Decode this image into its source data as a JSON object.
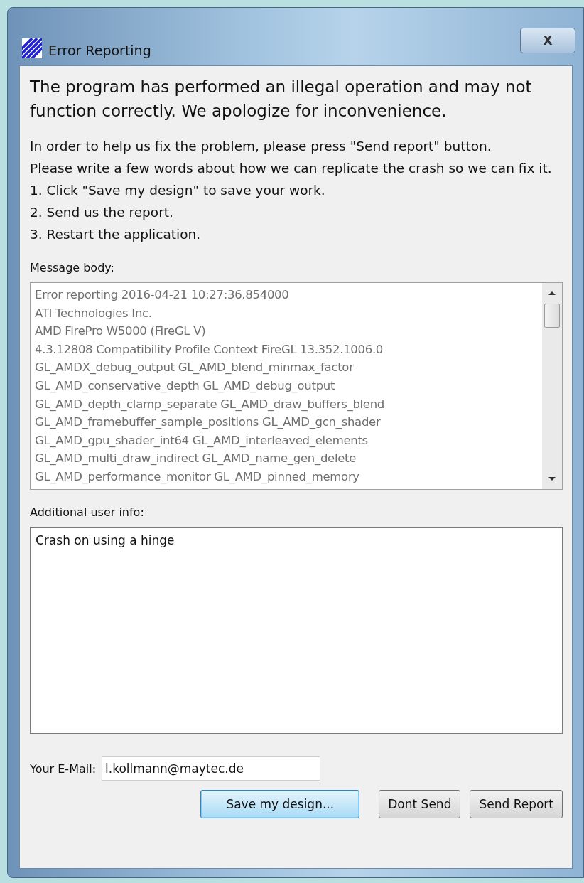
{
  "window": {
    "title": "Error Reporting",
    "close": "X"
  },
  "heading": "The program has performed an illegal operation and may not function correctly. We apologize for inconvenience.",
  "instructions": [
    "In order to help us fix the problem, please press \"Send report\" button.",
    "Please write a few words about how we can replicate the crash so we can fix it.",
    "1. Click \"Save my design\" to save your work.",
    "2. Send us the report.",
    "3. Restart the application."
  ],
  "message_body": {
    "label": "Message body:",
    "lines": [
      "Error reporting 2016-04-21 10:27:36.854000",
      "ATI Technologies Inc.",
      "AMD FirePro W5000 (FireGL V)",
      "4.3.12808 Compatibility Profile Context FireGL 13.352.1006.0",
      "GL_AMDX_debug_output GL_AMD_blend_minmax_factor",
      "GL_AMD_conservative_depth GL_AMD_debug_output",
      "GL_AMD_depth_clamp_separate GL_AMD_draw_buffers_blend",
      "GL_AMD_framebuffer_sample_positions GL_AMD_gcn_shader",
      "GL_AMD_gpu_shader_int64 GL_AMD_interleaved_elements",
      "GL_AMD_multi_draw_indirect GL_AMD_name_gen_delete",
      "GL_AMD_performance_monitor GL_AMD_pinned_memory"
    ]
  },
  "user_info": {
    "label": "Additional user info:",
    "value": "Crash on using a hinge"
  },
  "email": {
    "label": "Your E-Mail:",
    "value": "l.kollmann@maytec.de"
  },
  "buttons": [
    {
      "label": "Save my design...",
      "selected": true
    },
    {
      "label": "Dont Send",
      "selected": false
    },
    {
      "label": "Send Report",
      "selected": false
    }
  ]
}
